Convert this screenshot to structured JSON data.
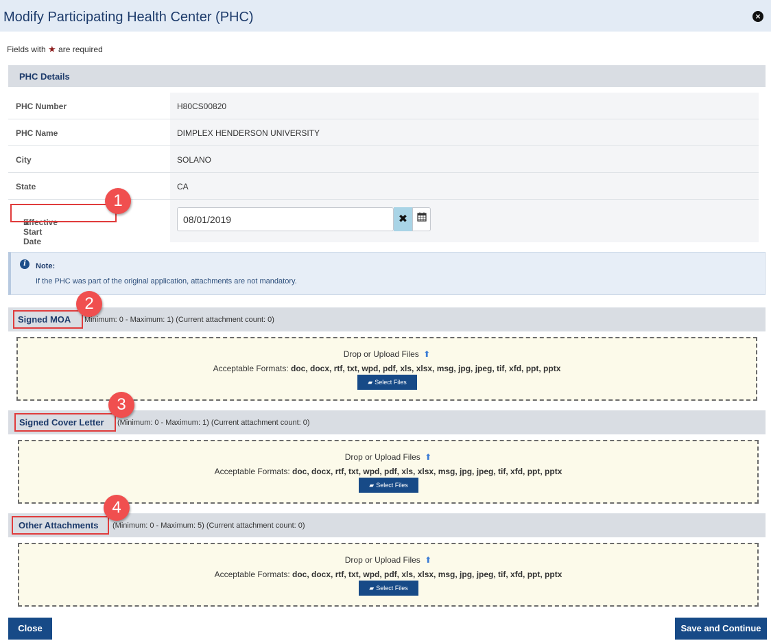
{
  "dialog": {
    "title": "Modify Participating Health Center (PHC)",
    "close_icon": "×"
  },
  "required_note": {
    "prefix": "Fields with",
    "star": "★",
    "suffix": "are required"
  },
  "section": {
    "title": "PHC Details"
  },
  "details": [
    {
      "label": "PHC Number",
      "value": "H80CS00820"
    },
    {
      "label": "PHC Name",
      "value": "DIMPLEX HENDERSON UNIVERSITY"
    },
    {
      "label": "City",
      "value": "SOLANO"
    },
    {
      "label": "State",
      "value": "CA"
    }
  ],
  "effective_date": {
    "star": "★",
    "label": "Effective Start Date",
    "value": "08/01/2019",
    "clear_icon": "✖",
    "calendar_icon": "📅"
  },
  "note": {
    "title": "Note:",
    "text": "If the PHC was part of the original application, attachments are not mandatory."
  },
  "attachments": [
    {
      "title": "Signed MOA",
      "meta": "Minimum: 0 - Maximum: 1) (Current attachment count: 0)"
    },
    {
      "title": "Signed Cover Letter",
      "meta": "(Minimum: 0 - Maximum: 1) (Current attachment count: 0)"
    },
    {
      "title": "Other Attachments",
      "meta": "(Minimum: 0 - Maximum: 5) (Current attachment count: 0)"
    }
  ],
  "upload": {
    "drop_text": "Drop or Upload Files",
    "formats_label": "Acceptable Formats:",
    "formats": "doc, docx, rtf, txt, wpd, pdf, xls, xlsx, msg, jpg, jpeg, tif, xfd, ppt, pptx",
    "select_label": "Select Files"
  },
  "badges": [
    "1",
    "2",
    "3",
    "4"
  ],
  "footer": {
    "close_label": "Close",
    "save_label": "Save and Continue"
  },
  "colors": {
    "header_bg": "#e3ebf5",
    "primary": "#174a87",
    "callout": "#e03b3b",
    "dropzone": "#fcfaea"
  }
}
